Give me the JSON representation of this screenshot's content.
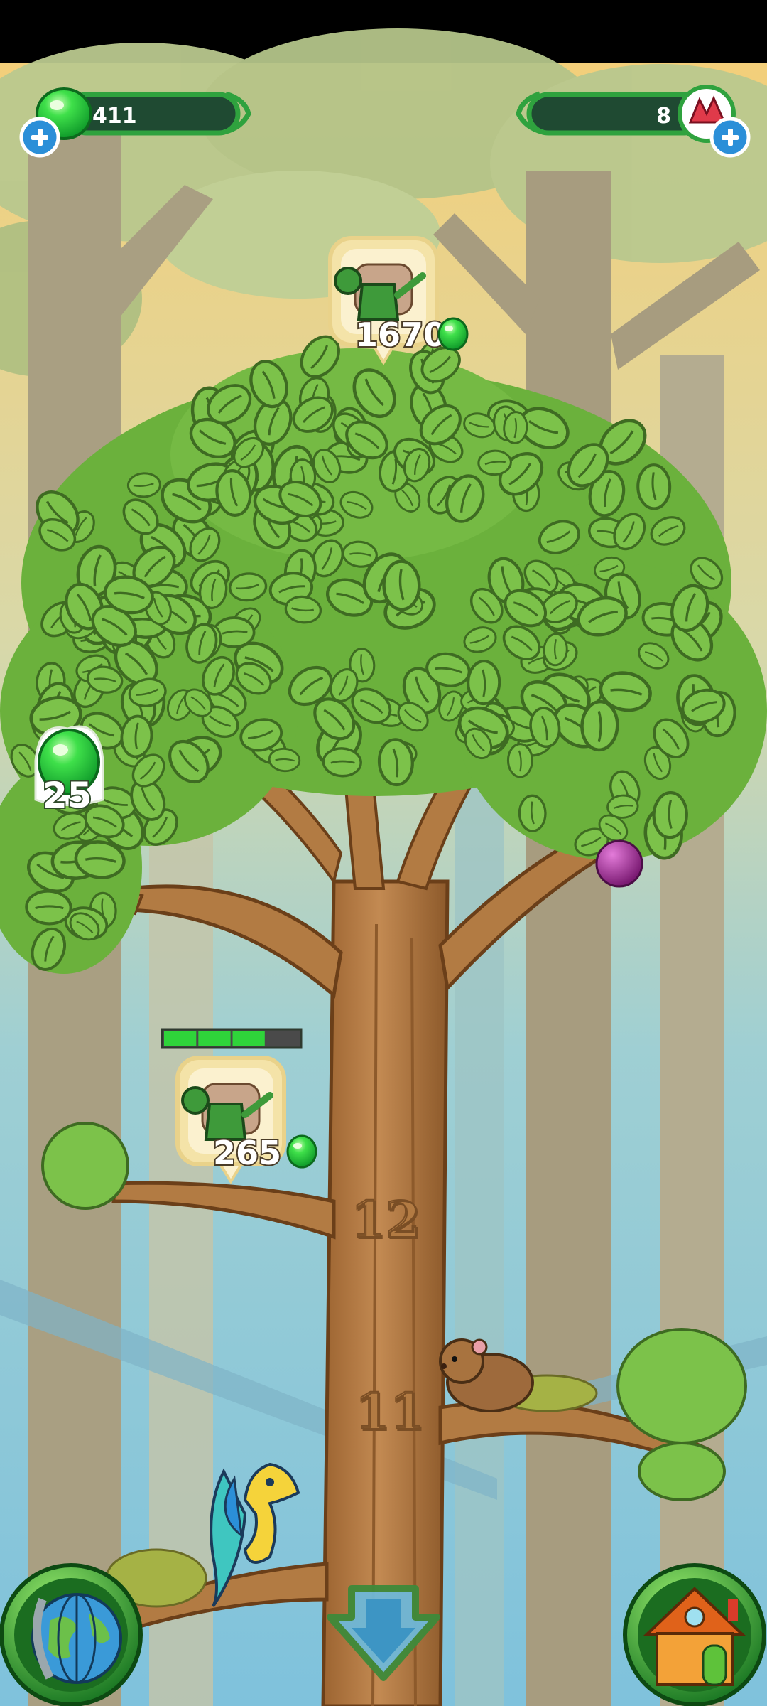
{
  "hud": {
    "gel_count": "411",
    "gem_count": "8"
  },
  "top_upgrade": {
    "cost": "1670",
    "icon": "watering-can-icon"
  },
  "branch_upgrade": {
    "cost": "265",
    "progress": 0.75,
    "segments": 4,
    "filled_segments": 3
  },
  "gel_drop": {
    "amount": "25"
  },
  "trunk_levels": [
    "12",
    "11"
  ],
  "buttons": {
    "map": "globe-icon",
    "down": "down-arrow-icon",
    "home": "house-icon"
  },
  "colors": {
    "gel_green": "#2fd43a",
    "hud_bar": "#1f4a32",
    "leaf": "#7cc24a",
    "trunk": "#b27b43",
    "sky": "#8fc8d6",
    "gem_red": "#e03a4a"
  }
}
